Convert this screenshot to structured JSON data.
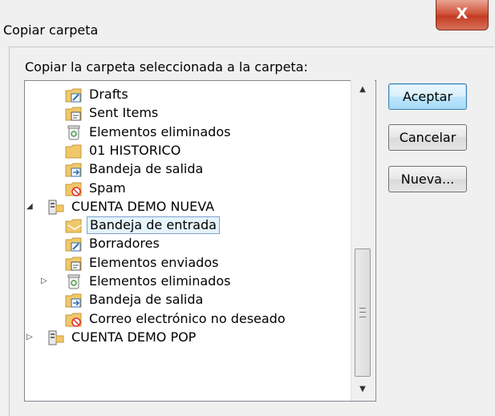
{
  "window": {
    "title": "Copiar carpeta",
    "close_glyph": "X"
  },
  "prompt": "Copiar la carpeta seleccionada a la carpeta:",
  "buttons": {
    "ok": "Aceptar",
    "cancel": "Cancelar",
    "new": "Nueva..."
  },
  "tree": [
    {
      "label": "Drafts",
      "icon": "drafts-folder-icon",
      "expander": ""
    },
    {
      "label": "Sent Items",
      "icon": "sent-folder-icon",
      "expander": ""
    },
    {
      "label": "Elementos eliminados",
      "icon": "trash-icon",
      "expander": ""
    },
    {
      "label": "01 HISTORICO",
      "icon": "folder-icon",
      "expander": ""
    },
    {
      "label": "Bandeja de salida",
      "icon": "outbox-folder-icon",
      "expander": ""
    },
    {
      "label": "Spam",
      "icon": "junk-folder-icon",
      "expander": ""
    },
    {
      "label": "CUENTA DEMO NUEVA",
      "icon": "account-icon",
      "expander": "◢"
    },
    {
      "label": "Bandeja de entrada",
      "icon": "inbox-folder-icon",
      "expander": "",
      "selected": true
    },
    {
      "label": "Borradores",
      "icon": "drafts-folder-icon",
      "expander": ""
    },
    {
      "label": "Elementos enviados",
      "icon": "sent-folder-icon",
      "expander": ""
    },
    {
      "label": "Elementos eliminados",
      "icon": "trash-icon",
      "expander": "▷"
    },
    {
      "label": "Bandeja de salida",
      "icon": "outbox-folder-icon",
      "expander": ""
    },
    {
      "label": "Correo electrónico no deseado",
      "icon": "junk-folder-icon",
      "expander": ""
    },
    {
      "label": "CUENTA DEMO POP",
      "icon": "account-icon",
      "expander": "▷"
    }
  ],
  "colors": {
    "folder": "#f0c86a",
    "selection": "#e5f3fb",
    "close": "#c7432a"
  }
}
